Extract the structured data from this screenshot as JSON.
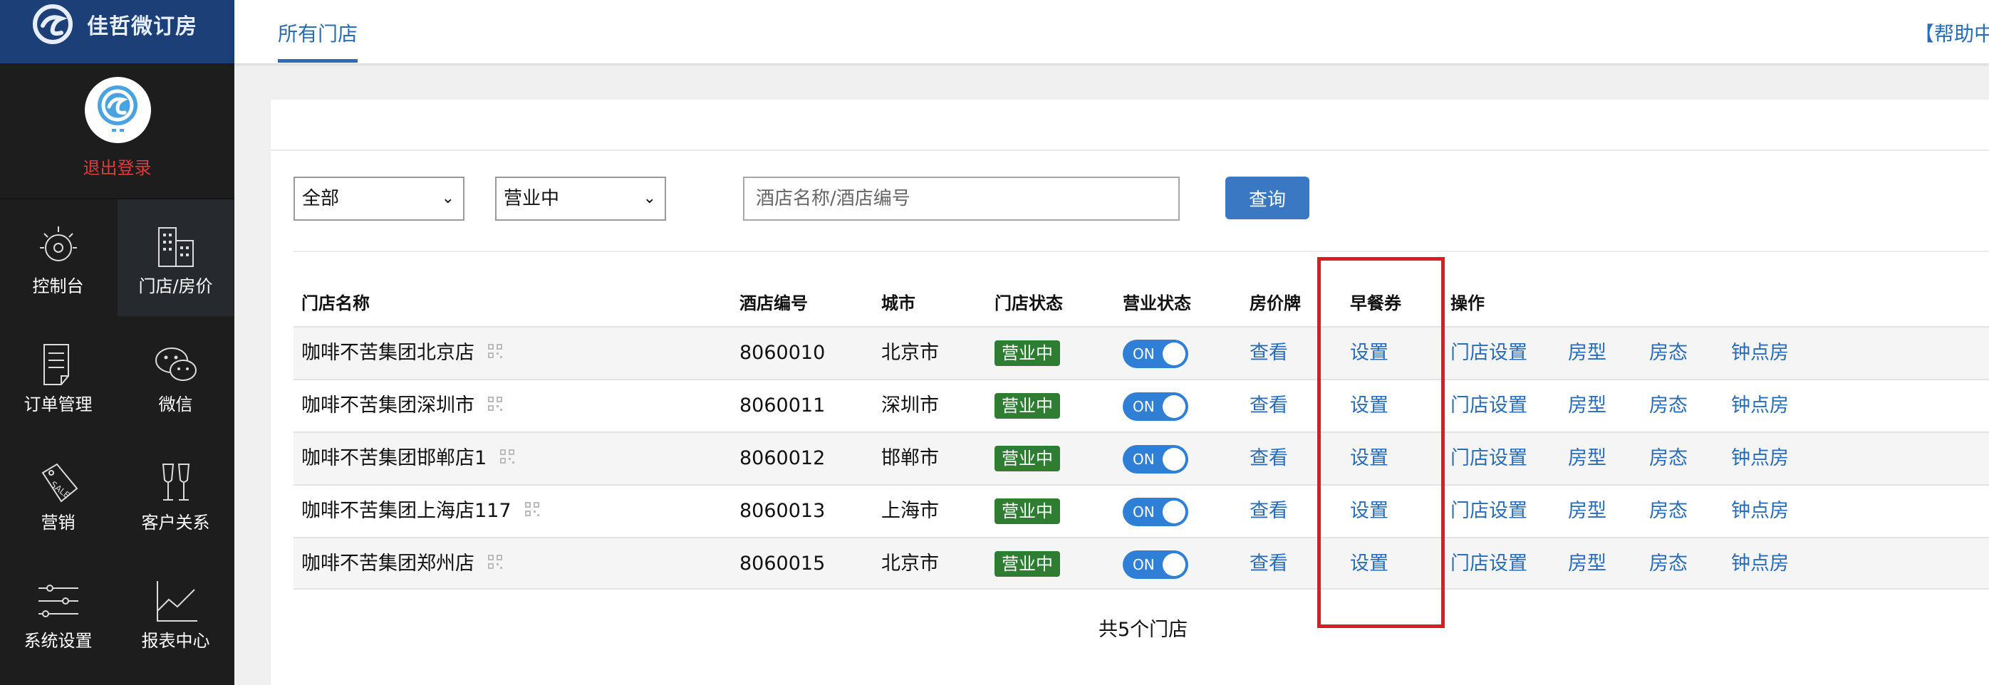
{
  "app": {
    "name": "佳哲微订房"
  },
  "profile": {
    "logout_label": "退出登录"
  },
  "sidebar": {
    "items": [
      {
        "label": "控制台",
        "icon": "dashboard-icon",
        "active": false
      },
      {
        "label": "门店/房价",
        "icon": "building-icon",
        "active": true
      },
      {
        "label": "订单管理",
        "icon": "document-icon",
        "active": false
      },
      {
        "label": "微信",
        "icon": "wechat-icon",
        "active": false
      },
      {
        "label": "营销",
        "icon": "sale-tag-icon",
        "active": false
      },
      {
        "label": "客户关系",
        "icon": "wine-glasses-icon",
        "active": false
      },
      {
        "label": "系统设置",
        "icon": "sliders-icon",
        "active": false
      },
      {
        "label": "报表中心",
        "icon": "line-chart-icon",
        "active": false
      }
    ]
  },
  "header": {
    "tab_label": "所有门店",
    "help_label": "【帮助中"
  },
  "filters": {
    "type_value": "全部",
    "status_value": "营业中",
    "search_placeholder": "酒店名称/酒店编号",
    "query_label": "查询"
  },
  "table": {
    "headers": [
      "门店名称",
      "酒店编号",
      "城市",
      "门店状态",
      "营业状态",
      "房价牌",
      "早餐券",
      "操作"
    ],
    "rows": [
      {
        "name": "咖啡不苦集团北京店",
        "code": "8060010",
        "city": "北京市",
        "store_status": "营业中",
        "toggle": "ON",
        "price_board": "查看",
        "breakfast": "设置",
        "actions": [
          "门店设置",
          "房型",
          "房态",
          "钟点房"
        ]
      },
      {
        "name": "咖啡不苦集团深圳市",
        "code": "8060011",
        "city": "深圳市",
        "store_status": "营业中",
        "toggle": "ON",
        "price_board": "查看",
        "breakfast": "设置",
        "actions": [
          "门店设置",
          "房型",
          "房态",
          "钟点房"
        ]
      },
      {
        "name": "咖啡不苦集团邯郸店1",
        "code": "8060012",
        "city": "邯郸市",
        "store_status": "营业中",
        "toggle": "ON",
        "price_board": "查看",
        "breakfast": "设置",
        "actions": [
          "门店设置",
          "房型",
          "房态",
          "钟点房"
        ]
      },
      {
        "name": "咖啡不苦集团上海店117",
        "code": "8060013",
        "city": "上海市",
        "store_status": "营业中",
        "toggle": "ON",
        "price_board": "查看",
        "breakfast": "设置",
        "actions": [
          "门店设置",
          "房型",
          "房态",
          "钟点房"
        ]
      },
      {
        "name": "咖啡不苦集团郑州店",
        "code": "8060015",
        "city": "北京市",
        "store_status": "营业中",
        "toggle": "ON",
        "price_board": "查看",
        "breakfast": "设置",
        "actions": [
          "门店设置",
          "房型",
          "房态",
          "钟点房"
        ]
      }
    ]
  },
  "footer": {
    "count_text": "共5个门店"
  },
  "colors": {
    "sidebar_bg": "#1d1d1d",
    "logo_bar_bg": "#1c3f77",
    "link": "#2a6cb6",
    "badge_green": "#2e7d32",
    "toggle_blue": "#2f7fd6",
    "highlight_red": "#e01b1b"
  }
}
